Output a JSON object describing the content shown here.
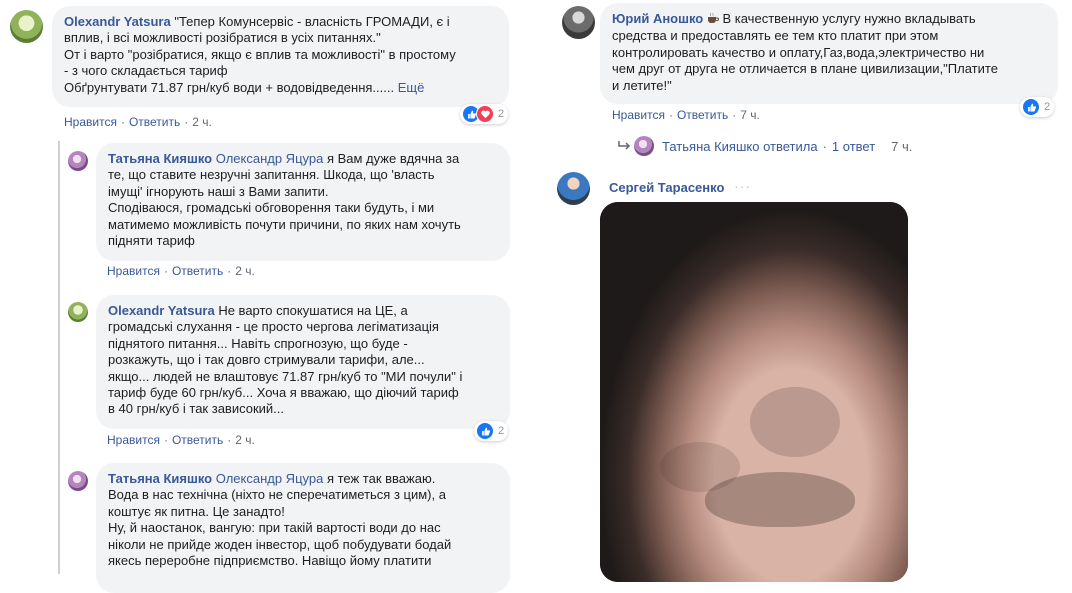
{
  "left_column": {
    "comments": [
      {
        "author": "Olexandr Yatsura",
        "lines": [
          "\"Тепер Комунсервіс - власність ГРОМАДИ, є і",
          "вплив, і всі можливості розібратися в усіх питаннях.\"",
          "От і варто \"розібратися, якщо є вплив та можливості\" в простому",
          "- з чого складається тариф",
          "Обґрунтувати 71.87 грн/куб води + водовідведення......"
        ],
        "see_more": "Ещё",
        "like": "Нравится",
        "reply": "Ответить",
        "time": "2 ч.",
        "reaction_count": "2"
      },
      {
        "author": "Татьяна Кияшко",
        "mention": "Олександр Яцура",
        "lines": [
          " я Вам дуже вдячна за",
          "те, що ставите незручні запитання. Шкода, що 'власть",
          "імущі' ігнорують наші з Вами запити.",
          "Сподіваюся, громадські обговорення таки будуть, і ми",
          "матимемо можливість почути причини, по яких нам хочуть",
          "підняти тариф"
        ],
        "like": "Нравится",
        "reply": "Ответить",
        "time": "2 ч."
      },
      {
        "author": "Olexandr Yatsura",
        "lines": [
          " Не варто спокушатися на ЦЕ, а",
          "громадські слухання - це просто чергова легіматизація",
          "піднятого питання... Навіть спрогнозую, що буде -",
          "розкажуть, що і так довго стримували тарифи, але...",
          "якщо... людей не влаштовує 71.87 грн/куб то \"МИ почули\" і",
          "тариф буде 60 грн/куб... Хоча я вважаю, що діючий тариф",
          "в 40 грн/куб і так зависокий..."
        ],
        "like": "Нравится",
        "reply": "Ответить",
        "time": "2 ч.",
        "reaction_count": "2"
      },
      {
        "author": "Татьяна Кияшко",
        "mention": "Олександр Яцура",
        "lines": [
          " я теж так вважаю.",
          "Вода в нас технічна (ніхто не сперечатиметься з цим), а",
          "коштує як питна. Це занадто!",
          "Ну, й наостанок, вангую: при такій вартості води до нас",
          "ніколи не прийде жоден інвестор, щоб побудувати бодай",
          "якесь переробне підприємство. Навіщо йому платити"
        ]
      }
    ]
  },
  "right_column": {
    "comment": {
      "author": "Юрий Аношко",
      "author_icon": "coffee-icon",
      "lines": [
        " В качественную услугу нужно вкладывать",
        "средства и предоставлять ее тем кто платит при этом",
        "контролировать качество и оплату,Газ,вода,электричество ни",
        "чем друг от друга не отличается в плане цивилизации,\"Платите",
        "и летите!\""
      ],
      "like": "Нравится",
      "reply": "Ответить",
      "time": "7 ч.",
      "reaction_count": "2"
    },
    "reply_summary": {
      "text": "Татьяна Кияшко ответила",
      "dot": "·",
      "count": "1 ответ",
      "time": "7 ч."
    },
    "gif_comment": {
      "author": "Сергей Тарасенко",
      "menu_icon": "more-options-icon"
    }
  },
  "colors": {
    "link": "#385898",
    "bubble": "#f2f3f5",
    "meta": "#606770",
    "like_blue": "#1877f2",
    "love_red": "#f33e58"
  }
}
